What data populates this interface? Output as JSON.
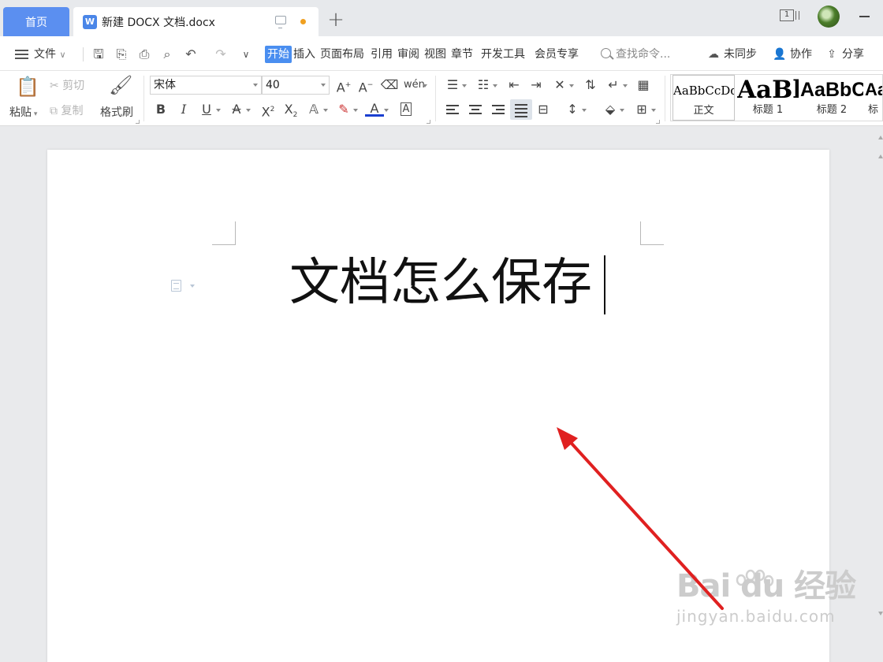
{
  "tabs": {
    "home_label": "首页",
    "doc_icon_letter": "W",
    "doc_title": "新建 DOCX 文档.docx",
    "window_count": "1"
  },
  "menu": {
    "file_label": "文件",
    "tabs": [
      "开始",
      "插入",
      "页面布局",
      "引用",
      "审阅",
      "视图",
      "章节",
      "开发工具",
      "会员专享"
    ],
    "active_tab": "开始",
    "search_placeholder": "查找命令...",
    "sync_label": "未同步",
    "collab_label": "协作",
    "share_label": "分享"
  },
  "ribbon": {
    "paste_label": "粘贴",
    "cut_label": "剪切",
    "copy_label": "复制",
    "format_painter_label": "格式刷",
    "font_name": "宋体",
    "font_size": "40",
    "styles": [
      {
        "preview": "AaBbCcDd",
        "name": "正文"
      },
      {
        "preview": "AaBl",
        "name": "标题 1"
      },
      {
        "preview": "AaBbC",
        "name": "标题 2"
      },
      {
        "preview": "Aa",
        "name": "标"
      }
    ]
  },
  "document": {
    "text": "文档怎么保存"
  },
  "watermark": {
    "brand": "Bai du 经验",
    "url": "jingyan.baidu.com"
  },
  "colors": {
    "accent": "#4a8ef0",
    "home_tab": "#5b8ff0",
    "unsaved_dot": "#f0a020",
    "annotation_arrow": "#e02020"
  }
}
